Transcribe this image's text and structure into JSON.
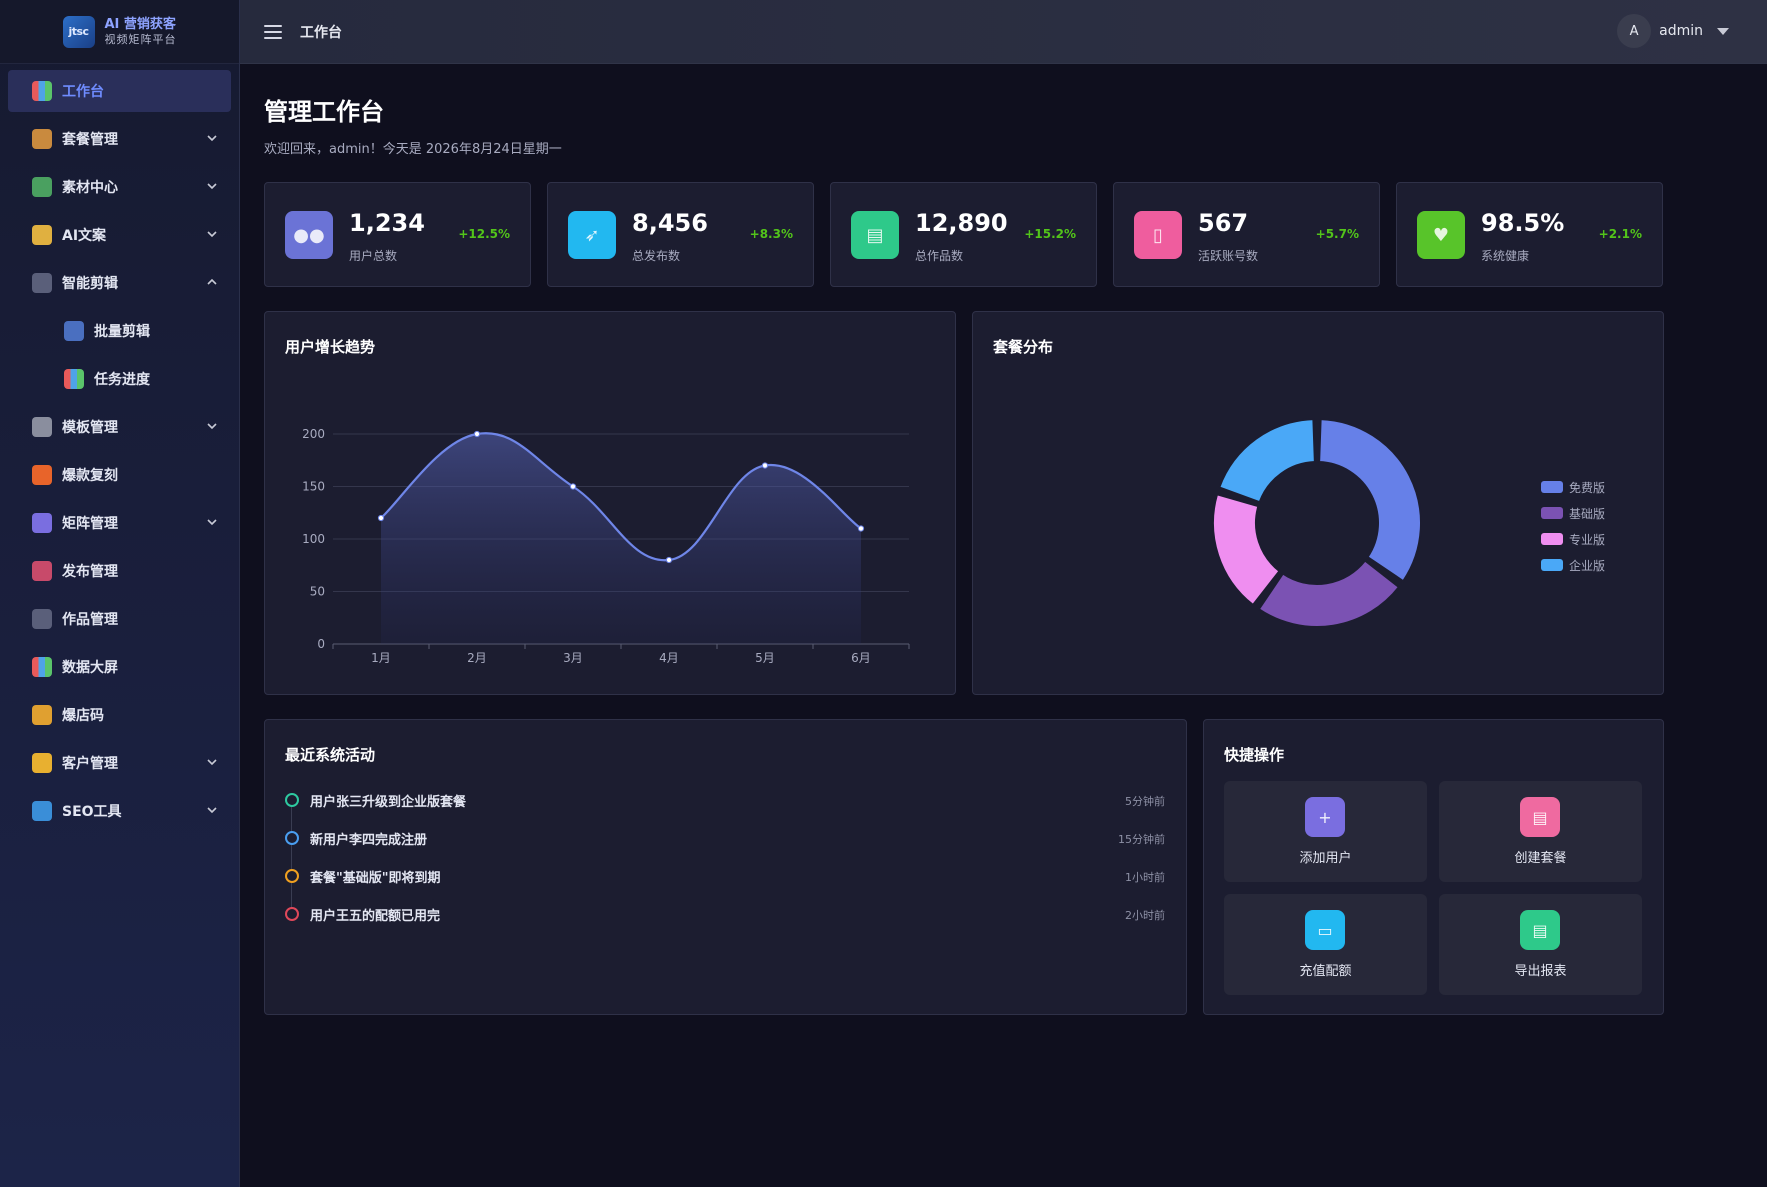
{
  "brand": {
    "mark": "jtsc",
    "title": "AI 营销获客",
    "subtitle": "视频矩阵平台"
  },
  "sidebar": {
    "items": [
      {
        "label": "工作台",
        "icon": "chart-icon",
        "active": true
      },
      {
        "label": "套餐管理",
        "icon": "package-icon",
        "expandable": true
      },
      {
        "label": "素材中心",
        "icon": "picture-icon",
        "expandable": true
      },
      {
        "label": "AI文案",
        "icon": "writing-icon",
        "expandable": true
      },
      {
        "label": "智能剪辑",
        "icon": "clapper-icon",
        "expanded": true
      },
      {
        "label": "批量剪辑",
        "icon": "film-icon",
        "sub": true
      },
      {
        "label": "任务进度",
        "icon": "chart-icon",
        "sub": true
      },
      {
        "label": "模板管理",
        "icon": "ruler-icon",
        "expandable": true
      },
      {
        "label": "爆款复刻",
        "icon": "fire-icon"
      },
      {
        "label": "矩阵管理",
        "icon": "users-icon",
        "expandable": true
      },
      {
        "label": "发布管理",
        "icon": "outbox-icon"
      },
      {
        "label": "作品管理",
        "icon": "clapper-icon"
      },
      {
        "label": "数据大屏",
        "icon": "chart-icon"
      },
      {
        "label": "爆店码",
        "icon": "tag-icon"
      },
      {
        "label": "客户管理",
        "icon": "handshake-icon",
        "expandable": true
      },
      {
        "label": "SEO工具",
        "icon": "magnifier-icon",
        "expandable": true
      }
    ]
  },
  "header": {
    "title": "工作台",
    "user_initial": "A",
    "user_name": "admin"
  },
  "page": {
    "title": "管理工作台",
    "welcome": "欢迎回来，admin！今天是 2026年8月24日星期一"
  },
  "stats": [
    {
      "value": "1,234",
      "label": "用户总数",
      "change": "+12.5%",
      "icon": "users-icon",
      "color": "#6b73d6"
    },
    {
      "value": "8,456",
      "label": "总发布数",
      "change": "+8.3%",
      "icon": "rocket-icon",
      "color": "#22b8f0"
    },
    {
      "value": "12,890",
      "label": "总作品数",
      "change": "+15.2%",
      "icon": "clapper-icon",
      "color": "#2ec98a"
    },
    {
      "value": "567",
      "label": "活跃账号数",
      "change": "+5.7%",
      "icon": "phone-icon",
      "color": "#ef5d9e"
    },
    {
      "value": "98.5%",
      "label": "系统健康",
      "change": "+2.1%",
      "icon": "heart-icon",
      "color": "#58c42a"
    }
  ],
  "growth_card": {
    "title": "用户增长趋势"
  },
  "plan_card": {
    "title": "套餐分布"
  },
  "chart_data": [
    {
      "type": "area",
      "x": [
        "1月",
        "2月",
        "3月",
        "4月",
        "5月",
        "6月"
      ],
      "values": [
        120,
        200,
        150,
        80,
        170,
        110
      ],
      "ylim": [
        0,
        200
      ],
      "yticks": [
        0,
        50,
        100,
        150,
        200
      ],
      "color": "#6f86e8",
      "grid": true
    },
    {
      "type": "pie",
      "donut": true,
      "labels": [
        "免费版",
        "基础版",
        "专业版",
        "企业版"
      ],
      "values": [
        35,
        25,
        20,
        20
      ],
      "colors": [
        "#6680e8",
        "#7b52b3",
        "#ef8ef0",
        "#4aa8f7"
      ],
      "legend_position": "right"
    }
  ],
  "activity": {
    "title": "最近系统活动",
    "items": [
      {
        "text": "用户张三升级到企业版套餐",
        "time": "5分钟前",
        "color": "#2ec9a0"
      },
      {
        "text": "新用户李四完成注册",
        "time": "15分钟前",
        "color": "#4a9ef0"
      },
      {
        "text": "套餐\"基础版\"即将到期",
        "time": "1小时前",
        "color": "#f0a020"
      },
      {
        "text": "用户王五的配额已用完",
        "time": "2小时前",
        "color": "#e0485a"
      }
    ]
  },
  "quick": {
    "title": "快捷操作",
    "actions": [
      {
        "label": "添加用户",
        "icon": "plus-icon",
        "color": "#7a6ee0"
      },
      {
        "label": "创建套餐",
        "icon": "document-icon",
        "color": "#ef6aa0"
      },
      {
        "label": "充值配额",
        "icon": "card-icon",
        "color": "#22b8f0"
      },
      {
        "label": "导出报表",
        "icon": "report-icon",
        "color": "#2ec98a"
      }
    ]
  }
}
